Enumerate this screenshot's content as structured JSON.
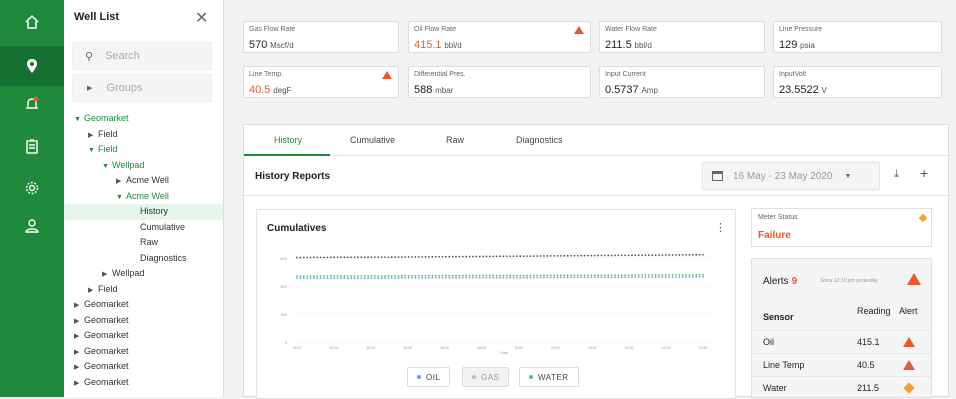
{
  "rail": {
    "icons": [
      "home-icon",
      "location-pin-icon",
      "alert-bell-icon",
      "clipboard-icon",
      "gear-icon",
      "user-icon"
    ]
  },
  "panel": {
    "title": "Well List",
    "search_placeholder": "Search",
    "groups_label": "Groups",
    "tree": [
      {
        "label": "Geomarket",
        "depth": 0,
        "caret": "down",
        "green": true
      },
      {
        "label": "Field",
        "depth": 1,
        "caret": "right"
      },
      {
        "label": "Field",
        "depth": 1,
        "caret": "down",
        "green": true
      },
      {
        "label": "Wellpad",
        "depth": 2,
        "caret": "down",
        "green": true
      },
      {
        "label": "Acme Well",
        "depth": 3,
        "caret": "right"
      },
      {
        "label": "Acme Well",
        "depth": 3,
        "caret": "down",
        "green": true
      },
      {
        "label": "History",
        "depth": 4,
        "caret": "",
        "selected": true
      },
      {
        "label": "Cumulative",
        "depth": 4,
        "caret": ""
      },
      {
        "label": "Raw",
        "depth": 4,
        "caret": ""
      },
      {
        "label": "Diagnostics",
        "depth": 4,
        "caret": ""
      },
      {
        "label": "Wellpad",
        "depth": 2,
        "caret": "right"
      },
      {
        "label": "Field",
        "depth": 1,
        "caret": "right"
      },
      {
        "label": "Geomarket",
        "depth": 0,
        "caret": "right"
      },
      {
        "label": "Geomarket",
        "depth": 0,
        "caret": "right"
      },
      {
        "label": "Geomarket",
        "depth": 0,
        "caret": "right"
      },
      {
        "label": "Geomarket",
        "depth": 0,
        "caret": "right"
      },
      {
        "label": "Geomarket",
        "depth": 0,
        "caret": "right"
      },
      {
        "label": "Geomarket",
        "depth": 0,
        "caret": "right"
      }
    ]
  },
  "metrics": [
    {
      "label": "Gas Flow Rate",
      "value": "570",
      "unit": "Mscf/d",
      "warn": false
    },
    {
      "label": "Oil Flow Rate",
      "value": "415.1",
      "unit": "bbl/d",
      "warn": true
    },
    {
      "label": "Water Flow Rate",
      "value": "211.5",
      "unit": "bbl/d",
      "warn": false
    },
    {
      "label": "Line Pressure",
      "value": "129",
      "unit": "psia",
      "warn": false
    },
    {
      "label": "Line Temp.",
      "value": "40.5",
      "unit": "degF",
      "warn": true
    },
    {
      "label": "Differential Pres.",
      "value": "588",
      "unit": "mbar",
      "warn": false
    },
    {
      "label": "Input Current",
      "value": "0.5737",
      "unit": "Amp",
      "warn": false
    },
    {
      "label": "InputVolt",
      "value": "23.5522",
      "unit": "V",
      "warn": false
    }
  ],
  "tabs": [
    "History",
    "Cumulative",
    "Raw",
    "Diagnostics"
  ],
  "history": {
    "heading": "History Reports",
    "date_range": "16 May - 23 May 2020"
  },
  "chart": {
    "title": "Cumulatives",
    "pills": [
      "OIL",
      "GAS",
      "WATER"
    ],
    "chart_data": {
      "type": "scatter",
      "ylim": [
        0,
        600
      ],
      "yticks": [
        "0",
        "200",
        "400",
        "600"
      ],
      "x": [
        "18:00",
        "18:10",
        "18:20",
        "18:30",
        "18:40",
        "18:50",
        "19:00",
        "19:10",
        "19:20",
        "19:30",
        "19:40",
        "19:50"
      ],
      "xlabel": "Date",
      "series": [
        {
          "name": "OIL",
          "color": "#555555",
          "values": [
            603,
            605,
            606,
            607,
            609,
            611,
            613,
            615,
            617,
            619,
            621,
            623
          ]
        },
        {
          "name": "WATER",
          "color": "#46c66a",
          "values": [
            470,
            472,
            471,
            473,
            474,
            475,
            474,
            476,
            477,
            478,
            479,
            480
          ]
        },
        {
          "name": "GAS",
          "color": "#6a9fe0",
          "values": [
            455,
            457,
            456,
            458,
            459,
            460,
            459,
            461,
            462,
            463,
            464,
            465
          ]
        }
      ]
    }
  },
  "meter": {
    "label": "Meter Status",
    "value": "Failure"
  },
  "alerts": {
    "title": "Alerts",
    "count": "9",
    "since": "Since 12:10 pm yesterday",
    "headers": {
      "sensor": "Sensor",
      "reading": "Reading",
      "alert": "Alert"
    },
    "rows": [
      {
        "sensor": "Oil",
        "reading": "415.1",
        "type": "tri"
      },
      {
        "sensor": "Line Temp",
        "reading": "40.5",
        "type": "tri"
      },
      {
        "sensor": "Water",
        "reading": "211.5",
        "type": "dia"
      }
    ]
  }
}
